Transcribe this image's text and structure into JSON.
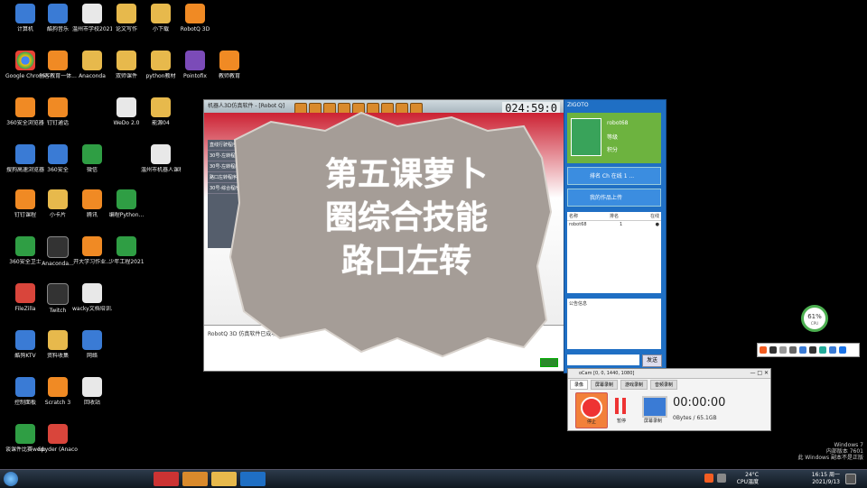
{
  "desktop_icons": [
    {
      "label": "计算机",
      "icon": "computer-icon"
    },
    {
      "label": "酷狗音乐",
      "icon": "kugou-icon"
    },
    {
      "label": "温州市学校2021年秋...",
      "icon": "doc-icon"
    },
    {
      "label": "论文写作",
      "icon": "folder-icon"
    },
    {
      "label": "小下载",
      "icon": "folder-icon"
    },
    {
      "label": "RobotQ 3D",
      "icon": "robotq-icon"
    },
    {
      "label": "Google Chrome",
      "icon": "chrome-icon"
    },
    {
      "label": "创客教育一体...",
      "icon": "app-icon"
    },
    {
      "label": "Anaconda",
      "icon": "box-icon"
    },
    {
      "label": "双师课件",
      "icon": "folder-icon"
    },
    {
      "label": "python教材",
      "icon": "folder-icon"
    },
    {
      "label": "Pointofix",
      "icon": "pointofix-icon"
    },
    {
      "label": "教师教育",
      "icon": "app-icon"
    },
    {
      "label": "360安全浏览器",
      "icon": "360-browser-icon"
    },
    {
      "label": "钉钉通话",
      "icon": "app-icon"
    },
    {
      "label": "WeDo 2.0",
      "icon": "wedo-icon"
    },
    {
      "label": "能源04",
      "icon": "folder-icon"
    },
    {
      "label": "搜狗高速浏览器",
      "icon": "sogou-browser-icon"
    },
    {
      "label": "360安全",
      "icon": "360-icon"
    },
    {
      "label": "微信",
      "icon": "wechat-icon"
    },
    {
      "label": "温州市机器人课程...",
      "icon": "doc-icon"
    },
    {
      "label": "钉钉课程",
      "icon": "app-icon"
    },
    {
      "label": "小卡片",
      "icon": "folder-icon"
    },
    {
      "label": "腾讯",
      "icon": "app-icon"
    },
    {
      "label": "编程Python...",
      "icon": "pdf-icon"
    },
    {
      "label": "360安全卫士",
      "icon": "360-guard-icon"
    },
    {
      "label": "Anaconda...",
      "icon": "anaconda-icon"
    },
    {
      "label": "开大学习作业...",
      "icon": "app-icon"
    },
    {
      "label": "少年工程2021",
      "icon": "book-icon"
    },
    {
      "label": "FileZilla",
      "icon": "filezilla-icon"
    },
    {
      "label": "Twitch",
      "icon": "twitch-icon"
    },
    {
      "label": "wacky文档培训...",
      "icon": "doc-icon"
    },
    {
      "label": "酷狗KTV",
      "icon": "kugou-icon"
    },
    {
      "label": "资料收集",
      "icon": "folder-icon"
    },
    {
      "label": "网络",
      "icon": "network-icon"
    },
    {
      "label": "控制面板",
      "icon": "control-panel-icon"
    },
    {
      "label": "Scratch 3",
      "icon": "scratch-icon"
    },
    {
      "label": "回收站",
      "icon": "recycle-bin-icon"
    },
    {
      "label": "谈课件比赛wedo4...",
      "icon": "book-icon"
    },
    {
      "label": "Spyder (Anaconda)",
      "icon": "spyder-icon"
    }
  ],
  "robotq": {
    "title": "机器人3D仿真软件 - [Robot Q]",
    "timer": "024:59:0",
    "panel_items": [
      "直线行驶程序1",
      "30号-左转程序1",
      "30号-左转程序2",
      "路口左转程序",
      "30号-综合程序1"
    ],
    "status_message": "RobotQ 3D 仿真软件已成功启动！"
  },
  "chat": {
    "title": "ZIGOTO",
    "username": "robot68",
    "user_fields": [
      "等级",
      "积分"
    ],
    "btn_rank": "排名 Ch 在线 1 ...",
    "btn_mine": "我的作品上传",
    "list_headers": [
      "名称",
      "排名",
      "在线"
    ],
    "list_rows": [
      [
        "robot68",
        "1",
        "●"
      ]
    ],
    "input_label": "公告信息",
    "send_label": "发送"
  },
  "overlay": {
    "line1": "第五课萝卜",
    "line2": "圈综合技能",
    "line3": "路口左转"
  },
  "recorder": {
    "title": "oCam [0, 0, 1440, 1080]",
    "tabs": [
      "录像",
      "屏幕录制",
      "游戏录制",
      "音频录制"
    ],
    "stop_label": "停止",
    "pause_label": "暂停",
    "screen_label": "屏幕录制",
    "time": "00:00:00",
    "size": "0Bytes / 65.1GB"
  },
  "gauge": {
    "percent": "61%",
    "sub": "CPU"
  },
  "watermark": {
    "line1": "Windows 7",
    "line2": "内部版本 7601",
    "line3": "此 Windows 副本不是正版"
  },
  "taskbar": {
    "tray_time": "16:15 周一",
    "tray_date": "2021/9/13",
    "weather": "24°C",
    "weather_desc": "CPU温度"
  }
}
